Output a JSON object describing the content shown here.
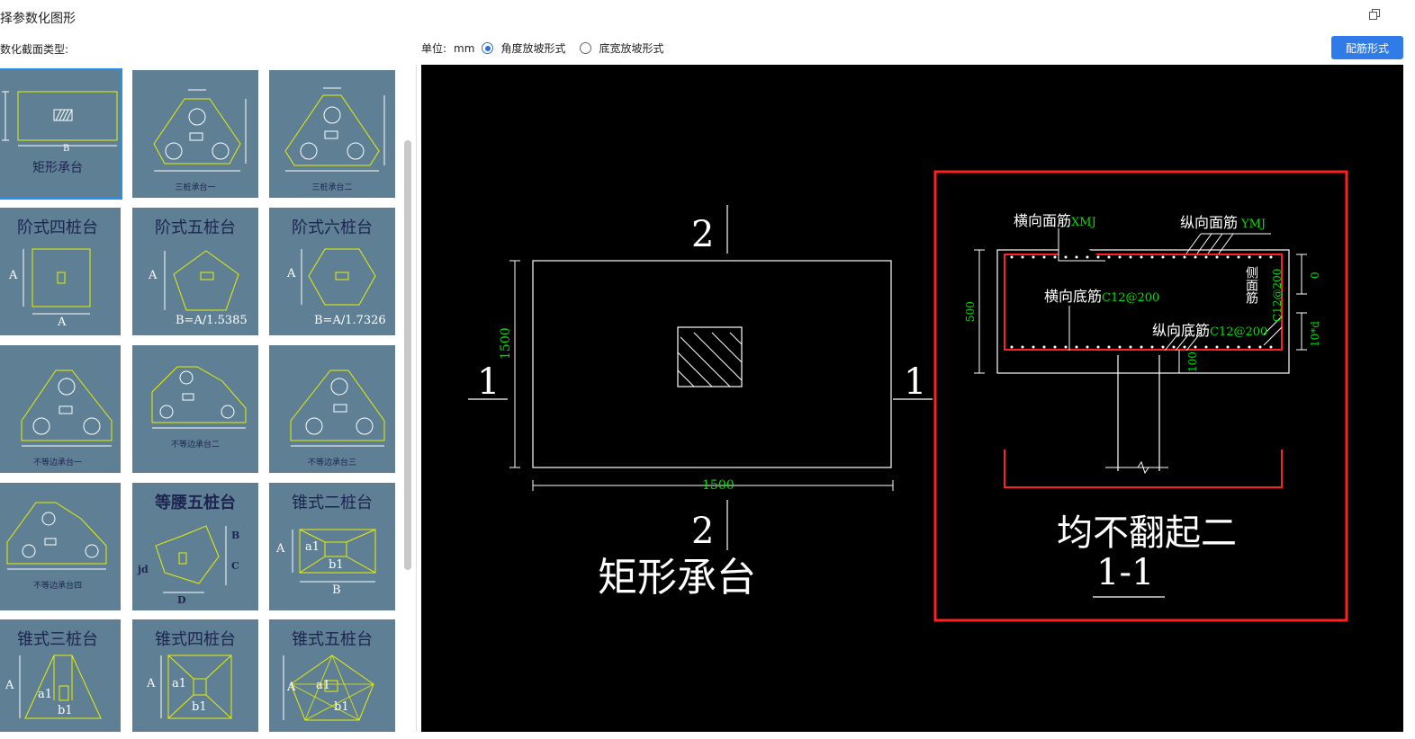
{
  "window": {
    "title": "择参数化图形"
  },
  "toolbar": {
    "section_label": "数化截面类型:",
    "unit_label": "单位:",
    "unit_value": "mm",
    "radio_options": [
      {
        "label": "角度放坡形式",
        "checked": true
      },
      {
        "label": "底宽放坡形式",
        "checked": false
      }
    ],
    "rebar_button": "配筋形式"
  },
  "gallery": {
    "thumbs": [
      {
        "id": "rect",
        "title": "",
        "subtitle": "矩形承台",
        "dims": [
          "B"
        ]
      },
      {
        "id": "pile3a",
        "title": "",
        "subtitle": "三桩承台一"
      },
      {
        "id": "pile3b",
        "title": "",
        "subtitle": "三桩承台二"
      },
      {
        "id": "step4",
        "title": "阶式四桩台",
        "dims": [
          "A",
          "A"
        ]
      },
      {
        "id": "step5",
        "title": "阶式五桩台",
        "dims": [
          "A",
          "B=A/1.5385"
        ]
      },
      {
        "id": "step6",
        "title": "阶式六桩台",
        "dims": [
          "A",
          "B=A/1.7326"
        ]
      },
      {
        "id": "uneq1",
        "title": "",
        "subtitle": "不等边承台一"
      },
      {
        "id": "uneq2",
        "title": "",
        "subtitle": "不等边承台二"
      },
      {
        "id": "uneq3",
        "title": "",
        "subtitle": "不等边承台三"
      },
      {
        "id": "uneq4",
        "title": "",
        "subtitle": "不等边承台四"
      },
      {
        "id": "iso5",
        "title": "等腰五桩台",
        "dims": [
          "B",
          "C",
          "jd",
          "D"
        ]
      },
      {
        "id": "cone2",
        "title": "锥式二桩台",
        "dims": [
          "A",
          "a1",
          "b1",
          "B"
        ]
      },
      {
        "id": "cone3",
        "title": "锥式三桩台",
        "dims": [
          "A",
          "a1",
          "b1"
        ]
      },
      {
        "id": "cone4",
        "title": "锥式四桩台",
        "dims": [
          "A",
          "a1",
          "b1"
        ]
      },
      {
        "id": "cone5",
        "title": "锥式五桩台",
        "dims": [
          "A",
          "a1",
          "b1"
        ]
      }
    ]
  },
  "cad": {
    "plan": {
      "section_mark_top": "2",
      "section_mark_bottom": "2",
      "section_mark_left": "1",
      "section_mark_right": "1",
      "height_dim": "1500",
      "width_dim": "1500",
      "name": "矩形承台"
    },
    "section": {
      "label_top_transverse": "横向面筋",
      "code_top_transverse": "XMJ",
      "label_top_longitudinal": "纵向面筋",
      "code_top_longitudinal": "YMJ",
      "label_bottom_transverse": "横向底筋",
      "code_bottom_transverse": "C12@200",
      "label_bottom_longitudinal": "纵向底筋",
      "code_bottom_longitudinal": "C12@200",
      "label_side": "侧面筋",
      "code_side": "C12@200",
      "height_dim": "500",
      "dim_zero": "0",
      "dim_10d": "10*d",
      "dim_100": "100",
      "style_name": "均不翻起二",
      "section_name": "1-1"
    },
    "colors": {
      "highlight": "#ff2020",
      "rebar": "#ff2020",
      "dimension": "#00e000",
      "line": "#ffffff"
    }
  }
}
